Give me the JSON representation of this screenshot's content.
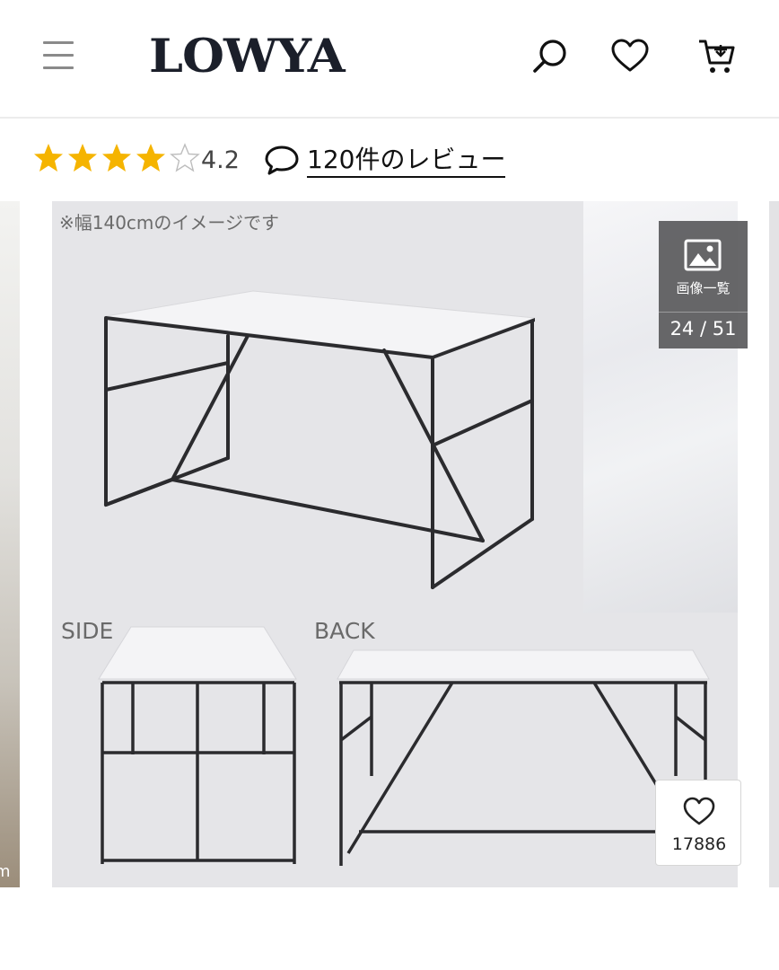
{
  "header": {
    "logo": "LOWYA",
    "menu_icon": "hamburger-menu-icon",
    "search_icon": "search-icon",
    "favorite_icon": "heart-icon",
    "cart_icon": "cart-icon"
  },
  "rating": {
    "score": 4.2,
    "score_text": "4.2",
    "max_stars": 5,
    "filled_stars": 4,
    "review_link_text": "120件のレビュー",
    "review_icon": "speech-bubble-icon",
    "star_color": "#f5b400"
  },
  "slide": {
    "caption": "※幅140cmのイメージです",
    "side_label": "SIDE",
    "back_label": "BACK",
    "partial_prev_text": "m"
  },
  "gallery": {
    "label": "画像一覧",
    "counter": "24 / 51",
    "icon": "image-icon"
  },
  "favorite": {
    "count": "17886",
    "icon": "heart-outline-icon"
  }
}
